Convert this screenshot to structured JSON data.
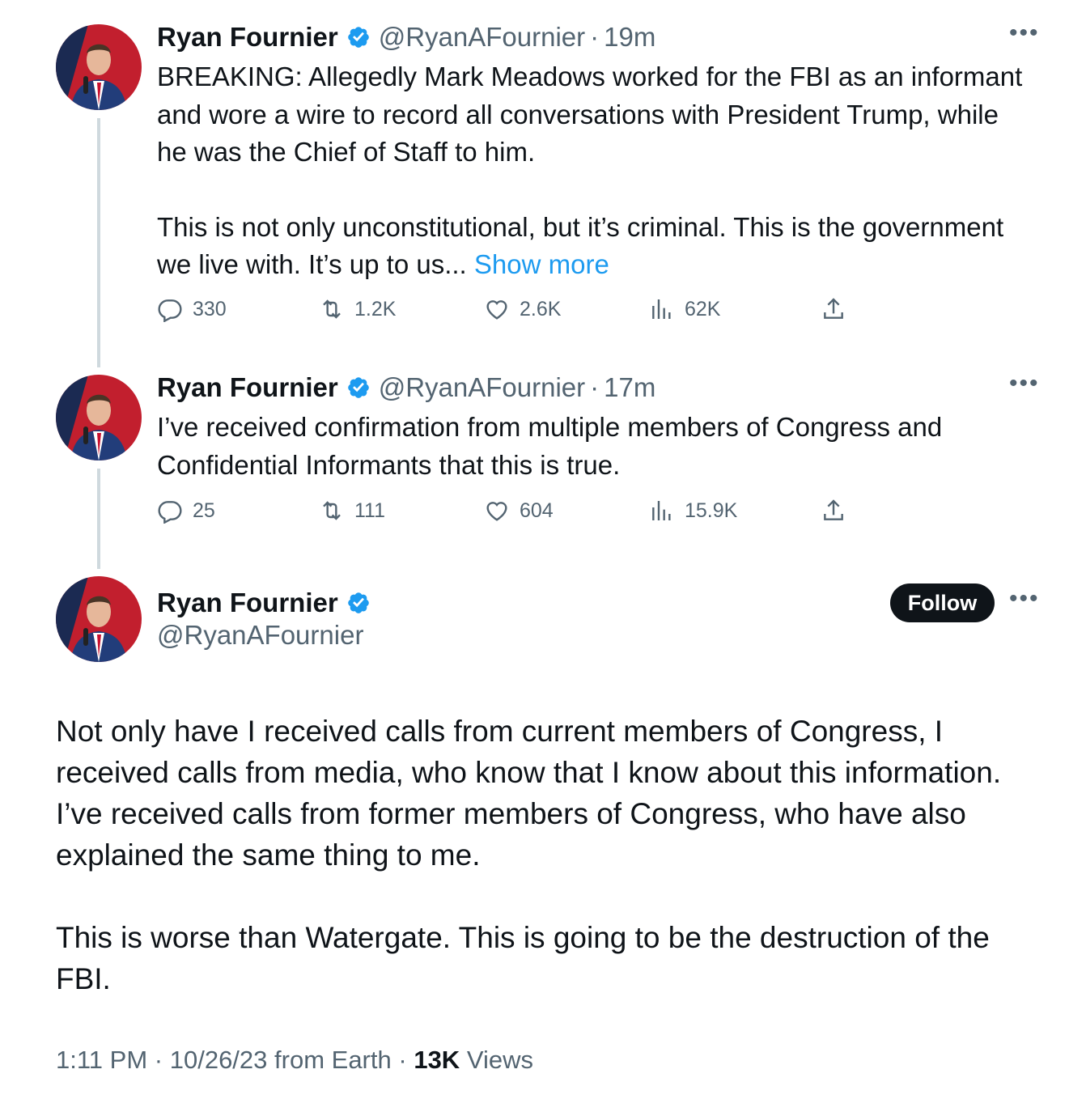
{
  "tweets": [
    {
      "name": "Ryan Fournier",
      "handle": "@RyanAFournier",
      "time": "19m",
      "text_p1": "BREAKING: Allegedly Mark Meadows worked for the FBI as an informant and wore a wire to record all conversations with President Trump, while he was the Chief of Staff to him.",
      "text_p2": "This is not only unconstitutional, but it’s criminal. This is the government we live with. It’s up to us...",
      "show_more": "Show more",
      "replies": "330",
      "retweets": "1.2K",
      "likes": "2.6K",
      "views": "62K"
    },
    {
      "name": "Ryan Fournier",
      "handle": "@RyanAFournier",
      "time": "17m",
      "text_p1": "I’ve received confirmation from multiple members of Congress and Confidential Informants that this is true.",
      "replies": "25",
      "retweets": "111",
      "likes": "604",
      "views": "15.9K"
    }
  ],
  "main": {
    "name": "Ryan Fournier",
    "handle": "@RyanAFournier",
    "follow_label": "Follow",
    "text_p1": "Not only have I received calls from current members of Congress, I received calls from media, who know that I know about this information. I’ve received calls from former members of Congress, who have also explained the same thing to me.",
    "text_p2": "This is worse than Watergate. This is going to be the destruction of the FBI.",
    "time": "1:11 PM",
    "date": "10/26/23",
    "source": "from Earth",
    "views_count": "13K",
    "views_label": "Views"
  },
  "colors": {
    "accent": "#1d9bf0",
    "text": "#0f1419",
    "muted": "#536471",
    "line": "#cfd9de"
  }
}
